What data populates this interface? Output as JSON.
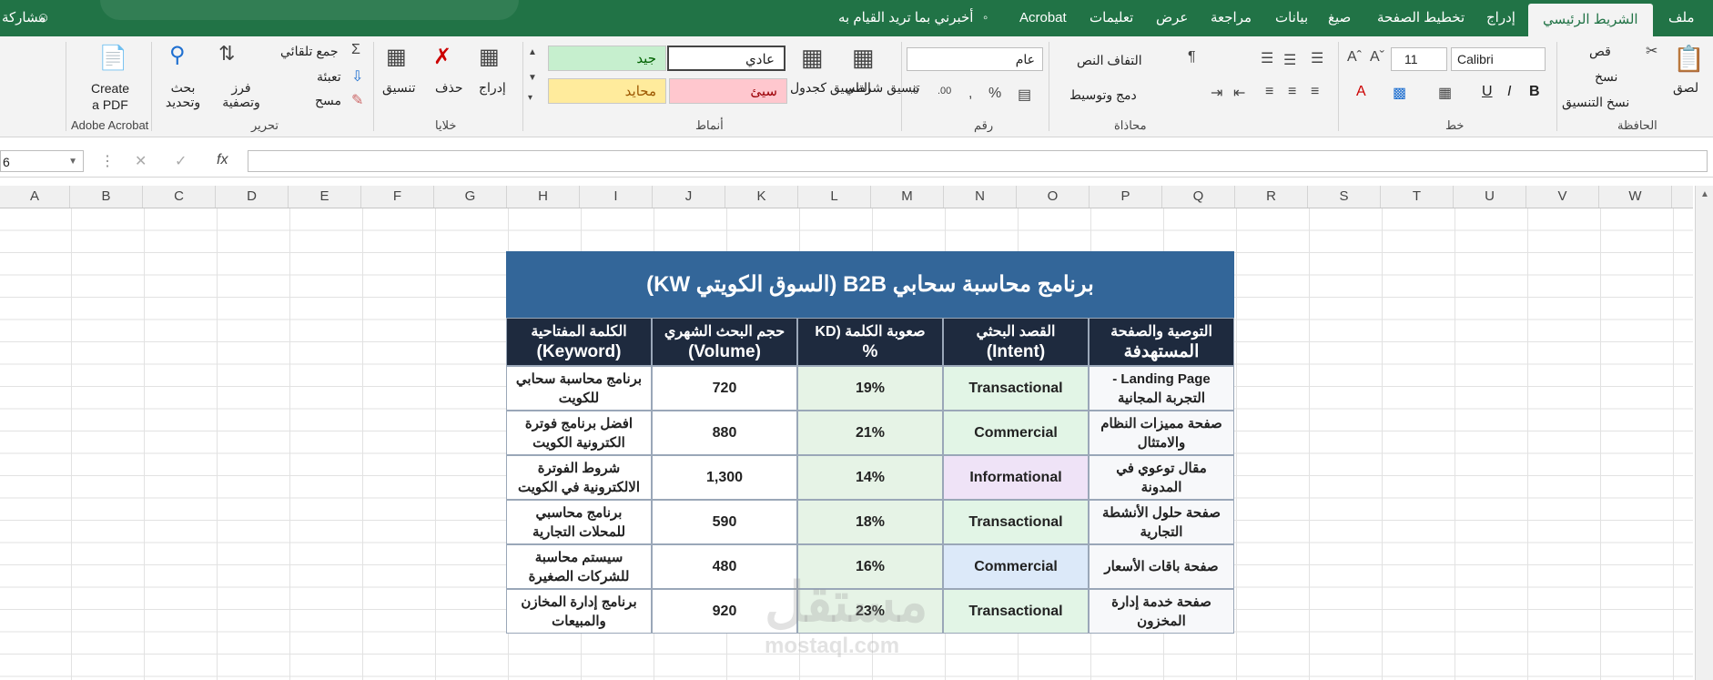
{
  "ribbon_tabs": [
    "ملف",
    "الشريط الرئيسي",
    "إدراج",
    "تخطيط الصفحة",
    "صيغ",
    "بيانات",
    "مراجعة",
    "عرض",
    "تعليمات",
    "Acrobat",
    "أخبرني بما تريد القيام به",
    "مشاركة"
  ],
  "ribbon": {
    "clipboard": {
      "paste": "لصق",
      "cut": "قص",
      "copy": "نسخ",
      "format_painter": "نسخ التنسيق",
      "label": "الحافظة"
    },
    "font": {
      "name": "Calibri",
      "size": "11",
      "label": "خط",
      "bold": "B",
      "italic": "I",
      "underline": "U"
    },
    "alignment": {
      "wrap": "التفاف النص",
      "merge": "دمج وتوسيط",
      "label": "محاذاة"
    },
    "number": {
      "format": "عام",
      "label": "رقم"
    },
    "styles": {
      "conditional": "تنسيق شرطي",
      "as_table": "التنسيق كجدول",
      "normal": "عادي",
      "good": "جيد",
      "bad": "سيئ",
      "neutral": "محايد",
      "label": "أنماط"
    },
    "cells": {
      "insert": "إدراج",
      "delete": "حذف",
      "format": "تنسيق",
      "label": "خلايا"
    },
    "editing": {
      "autosum": "جمع تلقائي",
      "fill": "تعبئة",
      "clear": "مسح",
      "sort": "فرز وتصفية",
      "find": "بحث وتحديد",
      "label": "تحرير"
    },
    "acrobat": {
      "create": "Create a PDF",
      "label": "Adobe Acrobat"
    }
  },
  "formula_bar": {
    "fx": "fx",
    "namebox": "6"
  },
  "columns": [
    "W",
    "V",
    "U",
    "T",
    "S",
    "R",
    "Q",
    "P",
    "O",
    "N",
    "M",
    "L",
    "K",
    "J",
    "I",
    "H",
    "G",
    "F",
    "E",
    "D",
    "C",
    "B",
    "A"
  ],
  "table": {
    "title": "برنامج محاسبة سحابي B2B (السوق الكويتي KW)",
    "headers": [
      {
        "l1": "التوصية والصفحة",
        "l2": "المستهدفة"
      },
      {
        "l1": "القصد البحثي",
        "l2": "(Intent)"
      },
      {
        "l1": "صعوبة الكلمة (KD",
        "l2": "%"
      },
      {
        "l1": "حجم البحث الشهري",
        "l2": "(Volume)"
      },
      {
        "l1": "الكلمة المفتاحية",
        "l2": "(Keyword)"
      }
    ],
    "rows": [
      {
        "page": "Landing Page - التجربة المجانية",
        "intent": "Transactional",
        "kd": "19%",
        "volume": "720",
        "keyword": "برنامج محاسبة سحابي للكويت"
      },
      {
        "page": "صفحة مميزات النظام والامتثال",
        "intent": "Commercial",
        "kd": "21%",
        "volume": "880",
        "keyword": "افضل برنامج فوترة الكترونية الكويت"
      },
      {
        "page": "مقال توعوي في المدونة",
        "intent": "Informational",
        "kd": "14%",
        "volume": "1,300",
        "keyword": "شروط الفوترة الالكترونية في الكويت"
      },
      {
        "page": "صفحة حلول الأنشطة التجارية",
        "intent": "Transactional",
        "kd": "18%",
        "volume": "590",
        "keyword": "برنامج محاسبي للمحلات التجارية"
      },
      {
        "page": "صفحة باقات الأسعار",
        "intent": "Commercial",
        "kd": "16%",
        "volume": "480",
        "keyword": "سيستم محاسبة للشركات الصغيرة"
      },
      {
        "page": "صفحة خدمة إدارة المخزون",
        "intent": "Transactional",
        "kd": "23%",
        "volume": "920",
        "keyword": "برنامج إدارة المخازن والمبيعات"
      }
    ]
  },
  "intent_colors": {
    "Transactional": "#e2f5e6",
    "Commercial_1": "#e2f5e6",
    "Informational": "#efe3f7",
    "Commercial_2": "#dce9f9"
  },
  "watermark": {
    "ar": "مستقل",
    "en": "mostaql.com"
  }
}
